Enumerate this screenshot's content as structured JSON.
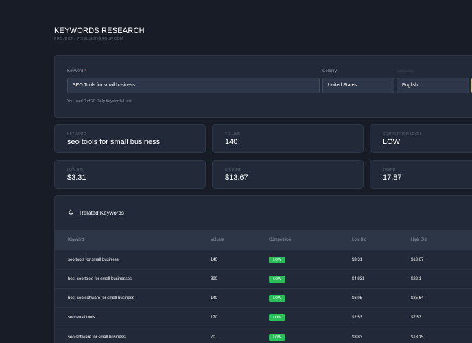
{
  "header": {
    "title": "KEYWORDS RESEARCH",
    "breadcrumb": "PROJECT / PIXELLIONGROUP.COM"
  },
  "form": {
    "keyword_label": "Keyword",
    "required_mark": "*",
    "keyword_value": "SEO Tools for small business",
    "country_label": "Country",
    "country_value": "United States",
    "language_label": "Language",
    "language_value": "English",
    "limit_note": "You used 0 of 20 Daily Keywords Limit."
  },
  "stats": {
    "keyword_label": "KEYWORD",
    "keyword_value": "seo tools for small business",
    "volume_label": "VOLUME",
    "volume_value": "140",
    "competition_label": "COMPETITION LEVEL",
    "competition_value": "LOW",
    "low_bid_label": "LOW BID",
    "low_bid_value": "$3.31",
    "high_bid_label": "HIGH BID",
    "high_bid_value": "$13.67",
    "trend_label": "TREND",
    "trend_value": "17.87"
  },
  "related": {
    "title": "Related Keywords",
    "columns": [
      "Keyword",
      "Volume",
      "Competition",
      "Low Bid",
      "High Bid"
    ],
    "rows": [
      {
        "keyword": "seo tools for small business",
        "volume": "140",
        "competition": "LOW",
        "low_bid": "$3.31",
        "high_bid": "$13.67"
      },
      {
        "keyword": "best seo tools for small businesses",
        "volume": "390",
        "competition": "LOW",
        "low_bid": "$4.931",
        "high_bid": "$22.1"
      },
      {
        "keyword": "best seo software for small business",
        "volume": "140",
        "competition": "LOW",
        "low_bid": "$6.05",
        "high_bid": "$25.64"
      },
      {
        "keyword": "seo small tools",
        "volume": "170",
        "competition": "LOW",
        "low_bid": "$2.53",
        "high_bid": "$7.53"
      },
      {
        "keyword": "seo software for small business",
        "volume": "70",
        "competition": "LOW",
        "low_bid": "$3.83",
        "high_bid": "$18.15"
      }
    ]
  },
  "colors": {
    "background": "#171c27",
    "card": "#222a39",
    "accent_yellow": "#e8c53a",
    "badge_green": "#2bbf5a"
  },
  "icons": {
    "related_header": "refresh-icon"
  }
}
